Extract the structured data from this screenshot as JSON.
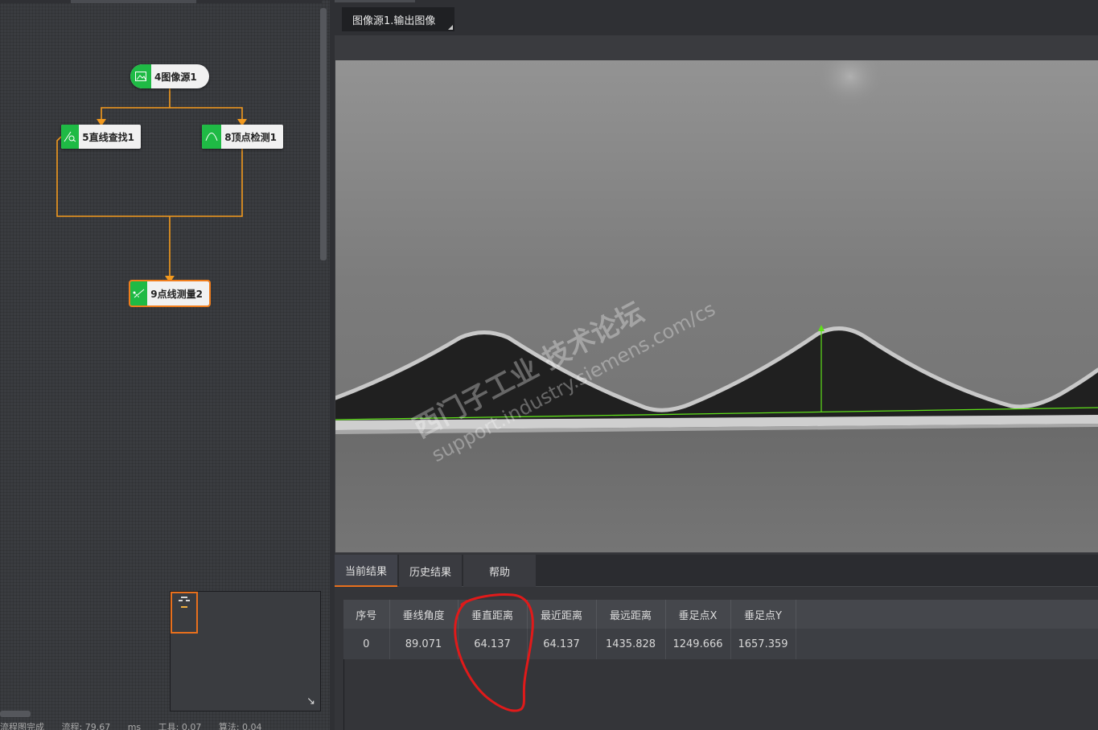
{
  "flow": {
    "nodes": [
      {
        "label": "4图像源1",
        "icon": "image-icon"
      },
      {
        "label": "5直线查找1",
        "icon": "line-find-icon"
      },
      {
        "label": "8顶点检测1",
        "icon": "peak-detect-icon"
      },
      {
        "label": "9点线测量2",
        "icon": "point-line-measure-icon"
      }
    ],
    "statusbar": [
      "流程图完成",
      "流程: 79.67",
      "ms",
      "工具: 0.07",
      "算法: 0.04"
    ]
  },
  "image": {
    "tab_label": "图像源1.输出图像",
    "watermark_line1": "西门子工业  技术论坛",
    "watermark_line2": "support.industry.siemens.com/cs",
    "overlay_color": "#5fe01a"
  },
  "results": {
    "tabs": [
      "当前结果",
      "历史结果",
      "帮助"
    ],
    "columns": [
      "序号",
      "垂线角度",
      "垂直距离",
      "最近距离",
      "最远距离",
      "垂足点X",
      "垂足点Y"
    ],
    "rows": [
      [
        "0",
        "89.071",
        "64.137",
        "64.137",
        "1435.828",
        "1249.666",
        "1657.359"
      ]
    ],
    "annotation_color": "#e01a1a"
  },
  "colors": {
    "accent": "#e8701d",
    "node_icon": "#1fba45",
    "edge": "#f39a1e"
  }
}
